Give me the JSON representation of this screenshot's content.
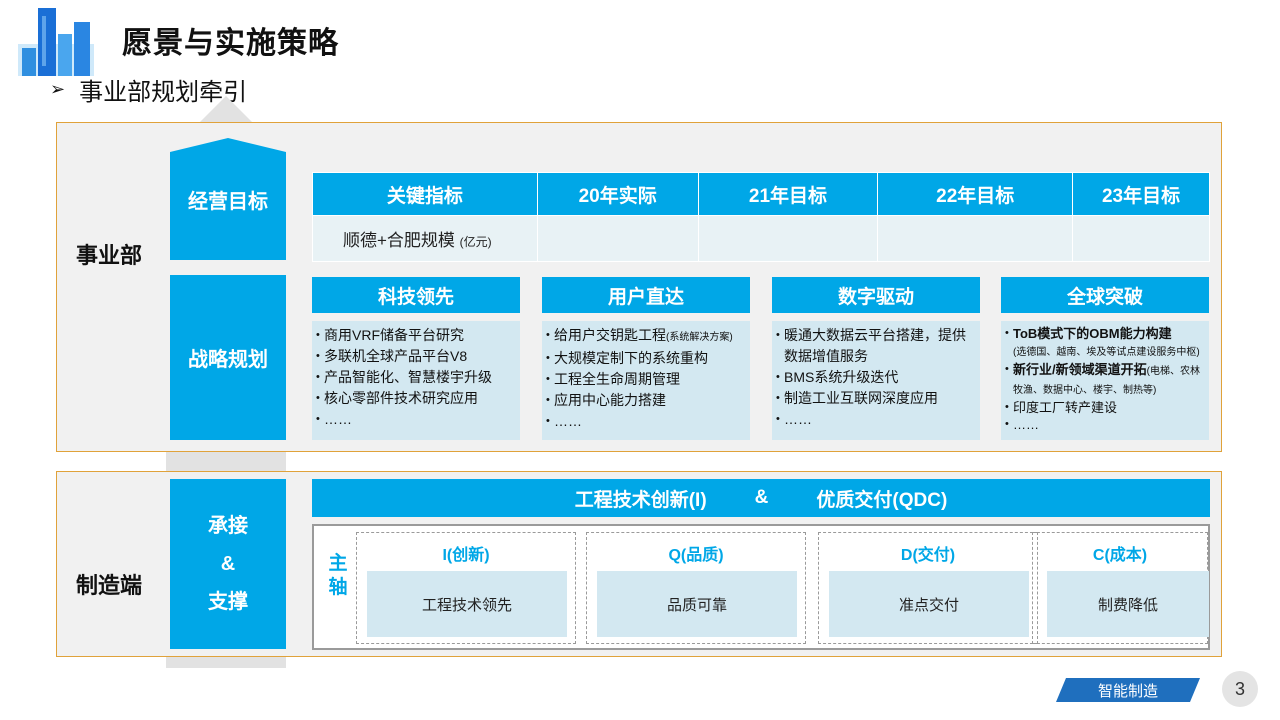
{
  "header": {
    "title": "愿景与实施策略",
    "subtitle_bullet": "➢",
    "subtitle": "事业部规划牵引"
  },
  "division": {
    "label": "事业部",
    "goal_box": "经营目标",
    "strategy_box": "战略规划",
    "kpi_table": {
      "headers": [
        "关键指标",
        "20年实际",
        "21年目标",
        "22年目标",
        "23年目标"
      ],
      "row_label": "顺德+合肥规模",
      "row_unit": "(亿元)",
      "row_values": [
        "",
        "",
        "",
        ""
      ]
    },
    "strategies": [
      {
        "title": "科技领先",
        "items": [
          "商用VRF储备平台研究",
          "多联机全球产品平台V8",
          "产品智能化、智慧楼宇升级",
          "核心零部件技术研究应用",
          "……"
        ]
      },
      {
        "title": "用户直达",
        "items": [
          "给用户交钥匙工程",
          "大规模定制下的系统重构",
          "工程全生命周期管理",
          "应用中心能力搭建",
          "……"
        ],
        "item0_note": "(系统解决方案)"
      },
      {
        "title": "数字驱动",
        "items": [
          "暖通大数据云平台搭建，提供数据增值服务",
          "BMS系统升级迭代",
          "制造工业互联网深度应用",
          "……"
        ]
      },
      {
        "title": "全球突破",
        "items": [
          "ToB模式下的OBM能力构建",
          "新行业/新领域渠道开拓",
          "印度工厂转产建设",
          "……"
        ],
        "item0_note": "(选德国、越南、埃及等试点建设服务中枢)",
        "item1_note": "(电梯、农林牧渔、数据中心、楼宇、制热等)"
      }
    ]
  },
  "manufacturing": {
    "label": "制造端",
    "support_box": [
      "承接",
      "&",
      "支撑"
    ],
    "banner_left": "工程技术创新(I)",
    "banner_amp": "&",
    "banner_right": "优质交付(QDC)",
    "axis_label": [
      "主",
      "轴"
    ],
    "pillars": [
      {
        "title": "I(创新)",
        "body": "工程技术领先"
      },
      {
        "title": "Q(品质)",
        "body": "品质可靠"
      },
      {
        "title": "D(交付)",
        "body": "准点交付"
      },
      {
        "title": "C(成本)",
        "body": "制费降低"
      }
    ]
  },
  "footer": {
    "tag": "智能制造",
    "page_number": "3"
  },
  "colors": {
    "accent": "#00a7e7",
    "light_block": "#d3e8f1",
    "panel_border": "#e0a23a",
    "footer_tag": "#1f6fbe"
  },
  "icons": {
    "logo": "building-skyline-logo",
    "background_arrow": "up-arrow-shape"
  }
}
